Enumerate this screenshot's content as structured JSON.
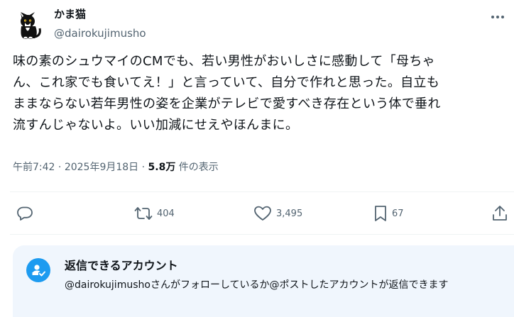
{
  "author": {
    "display_name": "かま猫",
    "handle": "@dairokujimusho",
    "avatar_icon": "cat-avatar-icon"
  },
  "tweet": {
    "text": "味の素のシュウマイのCMでも、若い男性がおいしさに感動して「母ちゃ\nん、これ家でも食いてえ！」と言っていて、自分で作れと思った。自立も\nままならない若年男性の姿を企業がテレビで愛すべき存在という体で垂れ\n流すんじゃないよ。いい加減にせえやほんまに。",
    "time": "午前7:42",
    "separator": "·",
    "date": "2025年9月18日",
    "views_count": "5.8万",
    "views_label": "件の表示"
  },
  "actions": {
    "reply_icon": "reply-icon",
    "retweet_icon": "retweet-icon",
    "retweet_count": "404",
    "like_icon": "heart-icon",
    "like_count": "3,495",
    "bookmark_icon": "bookmark-icon",
    "bookmark_count": "67",
    "share_icon": "share-icon"
  },
  "reply_restriction": {
    "title": "返信できるアカウント",
    "body": "@dairokujimushoさんがフォローしているか@ポストしたアカウントが返信できます",
    "icon": "at-person-check-icon"
  },
  "colors": {
    "text": "#0f1419",
    "muted": "#536471",
    "accent": "#1d9bf0",
    "card_bg": "#f0f6fd"
  }
}
